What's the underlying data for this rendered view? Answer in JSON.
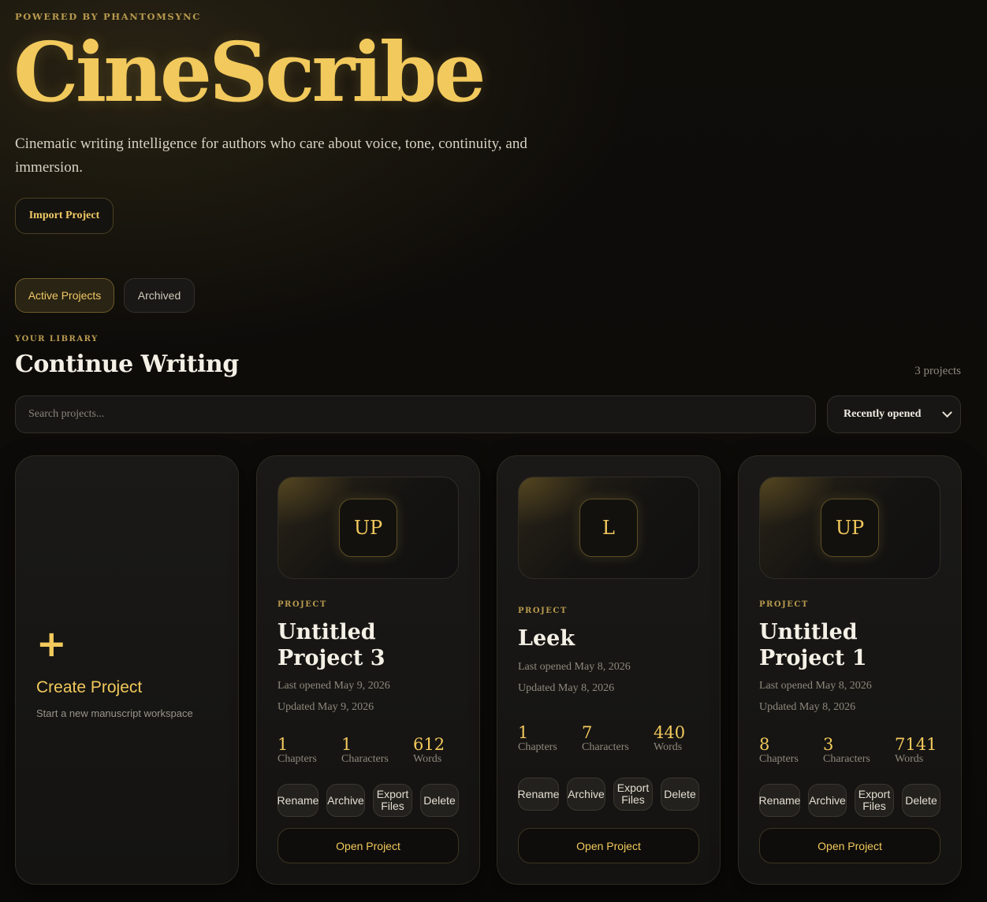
{
  "header": {
    "powered_by": "POWERED BY PHANTOMSYNC",
    "brand": "CineScribe",
    "tagline": "Cinematic writing intelligence for authors who care about voice, tone, continuity, and immersion.",
    "import_label": "Import Project"
  },
  "tabs": {
    "active": "Active Projects",
    "archived": "Archived"
  },
  "library": {
    "eyebrow": "YOUR LIBRARY",
    "title": "Continue Writing",
    "count": "3 projects",
    "search_placeholder": "Search projects...",
    "sort_selected": "Recently opened"
  },
  "create": {
    "title": "Create Project",
    "subtitle": "Start a new manuscript workspace"
  },
  "labels": {
    "kicker": "PROJECT",
    "chapters": "Chapters",
    "characters": "Characters",
    "words": "Words",
    "rename": "Rename",
    "archive": "Archive",
    "export": "Export Files",
    "delete": "Delete",
    "open": "Open Project"
  },
  "projects": [
    {
      "initials": "UP",
      "title": "Untitled Project 3",
      "last_opened": "Last opened May 9, 2026",
      "updated": "Updated May 9, 2026",
      "chapters": "1",
      "characters": "1",
      "words": "612"
    },
    {
      "initials": "L",
      "title": "Leek",
      "last_opened": "Last opened May 8, 2026",
      "updated": "Updated May 8, 2026",
      "chapters": "1",
      "characters": "7",
      "words": "440"
    },
    {
      "initials": "UP",
      "title": "Untitled Project 1",
      "last_opened": "Last opened May 8, 2026",
      "updated": "Updated May 8, 2026",
      "chapters": "8",
      "characters": "3",
      "words": "7141"
    }
  ],
  "colors": {
    "accent": "#f2c95c",
    "background": "#0a0907",
    "card": "#1a1917"
  }
}
